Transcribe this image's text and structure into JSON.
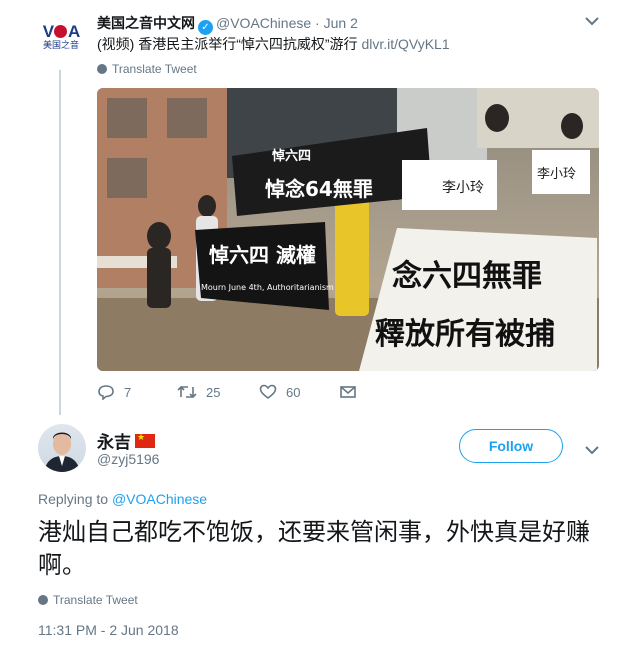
{
  "original_tweet": {
    "avatar_logo": "VOA",
    "avatar_sub": "美国之音",
    "display_name": "美国之音中文网",
    "handle": "@VOAChinese",
    "separator": "·",
    "date": "Jun 2",
    "text": "(视频) 香港民主派举行“悼六四抗威权”游行 ",
    "link": "dlvr.it/QVyKL1",
    "translate_label": "Translate Tweet",
    "media": {
      "banner_top": "悼六四",
      "banner_mid": "悼念64無罪",
      "banner_black": "悼六四 滅權",
      "banner_english": "Mourn June 4th, Authoritarianism",
      "banner_white_1": "念六四無罪",
      "banner_white_2": "釋放所有被捕",
      "sign_1": "李小玲",
      "sign_2": "李小玲"
    },
    "counts": {
      "replies": "7",
      "retweets": "25",
      "likes": "60"
    }
  },
  "reply": {
    "display_name": "永吉",
    "handle": "@zyj5196",
    "follow_label": "Follow",
    "replying_prefix": "Replying to ",
    "replying_to": "@VOAChinese",
    "text": "港灿自己都吃不饱饭，还要来管闲事，外快真是好赚啊。",
    "translate_label": "Translate Tweet",
    "timestamp": "11:31 PM - 2 Jun 2018"
  },
  "icons": [
    "verified-badge-icon",
    "chevron-down-icon",
    "globe-icon",
    "reply-icon",
    "retweet-icon",
    "like-icon",
    "message-icon",
    "china-flag-icon"
  ],
  "colors": {
    "accent": "#1da1f2",
    "muted": "#657786",
    "text": "#14171a",
    "thread_line": "#ccd6dd"
  }
}
